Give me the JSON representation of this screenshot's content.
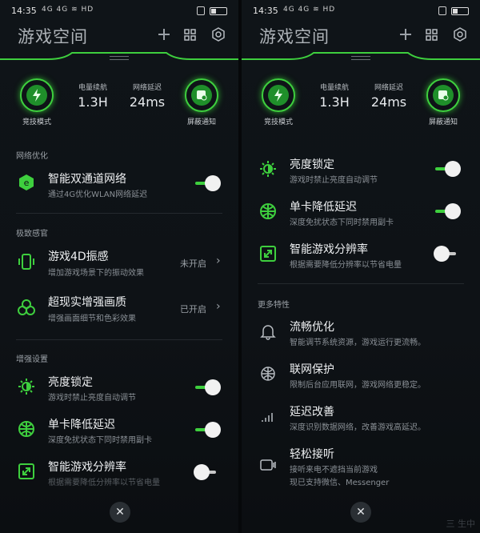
{
  "status": {
    "time": "14:35",
    "signals": "4G 4G ≋ HD"
  },
  "header": {
    "title": "游戏空间",
    "add_icon": "plus-icon",
    "grid_icon": "grid-icon",
    "settings_icon": "hexagon-gear-icon"
  },
  "stats": {
    "mode_label": "竞技模式",
    "battery_label": "电量续航",
    "battery_value": "1.3H",
    "latency_label": "网络延迟",
    "latency_value": "24ms",
    "block_label": "屏蔽通知"
  },
  "left": {
    "section1": "网络优化",
    "dual": {
      "title": "智能双通道网络",
      "sub": "通过4G优化WLAN网络延迟",
      "on": true
    },
    "section2": "极致感官",
    "vib": {
      "title": "游戏4D振感",
      "sub": "增加游戏场景下的振动效果",
      "value": "未开启"
    },
    "hdr": {
      "title": "超现实增强画质",
      "sub": "增强画面细节和色彩效果",
      "value": "已开启"
    },
    "section3": "增强设置",
    "bright": {
      "title": "亮度锁定",
      "sub": "游戏时禁止亮度自动调节",
      "on": true
    },
    "sim": {
      "title": "单卡降低延迟",
      "sub": "深度免扰状态下同时禁用副卡",
      "on": true
    },
    "res": {
      "title": "智能游戏分辨率",
      "sub": "根据需要降低分辨率以节省电量",
      "on": false
    }
  },
  "right": {
    "bright": {
      "title": "亮度锁定",
      "sub": "游戏时禁止亮度自动调节",
      "on": true
    },
    "sim": {
      "title": "单卡降低延迟",
      "sub": "深度免扰状态下同时禁用副卡",
      "on": true
    },
    "res": {
      "title": "智能游戏分辨率",
      "sub": "根据需要降低分辨率以节省电量",
      "on": false
    },
    "section_more": "更多特性",
    "smooth": {
      "title": "流畅优化",
      "sub": "智能调节系统资源，游戏运行更流畅。"
    },
    "net": {
      "title": "联网保护",
      "sub": "限制后台应用联网，游戏网络更稳定。"
    },
    "delay": {
      "title": "延迟改善",
      "sub": "深度识别数据网络，改善游戏高延迟。"
    },
    "answer": {
      "title": "轻松接听",
      "sub1": "接听来电不遮挡当前游戏",
      "sub2": "现已支持微信、Messenger"
    }
  },
  "close_symbol": "✕",
  "watermark": "三 生中",
  "colors": {
    "accent": "#3ecf3e",
    "bg": "#0e1216"
  }
}
